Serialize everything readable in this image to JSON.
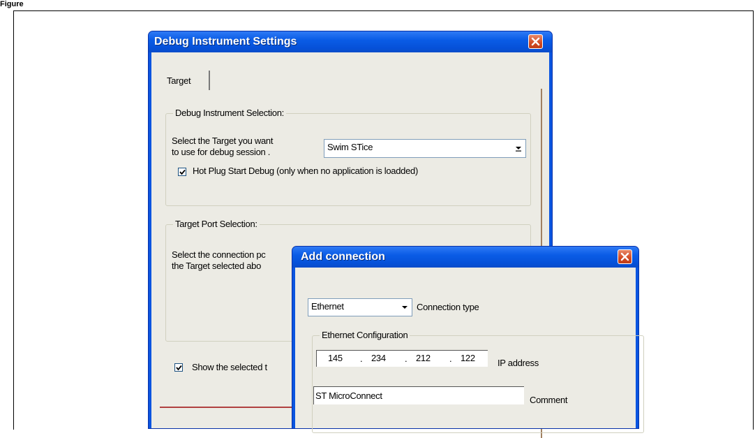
{
  "figure_label": "Figure",
  "debug_window": {
    "title": "Debug Instrument Settings",
    "tab": "Target",
    "instrument_group": {
      "label": "Debug Instrument Selection:",
      "prompt_line1": "Select the Target you want",
      "prompt_line2": "to use for debug session .",
      "target_value": "Swim STice",
      "hot_plug_checked": true,
      "hot_plug_label": "Hot Plug Start Debug (only when no application is loadded)"
    },
    "port_group": {
      "label": "Target Port Selection:",
      "prompt_line1": "Select the connection pc",
      "prompt_line2": "the Target selected abo"
    },
    "show_checked": true,
    "show_label": "Show the selected t"
  },
  "add_connection": {
    "title": "Add connection",
    "connection_type_value": "Ethernet",
    "connection_type_label": "Connection type",
    "ethernet_group_label": "Ethernet Configuration",
    "ip_octets": [
      "145",
      "234",
      "212",
      "122"
    ],
    "ip_label": "IP address",
    "comment_value": "ST MicroConnect",
    "comment_label": "Comment"
  },
  "icons": {
    "close": "close-icon",
    "dropdown": "chevron-down-icon",
    "check": "checkmark-icon"
  },
  "colors": {
    "titlebar": "#0a5ce6",
    "close_button": "#d24a22",
    "client": "#ecebe4"
  }
}
